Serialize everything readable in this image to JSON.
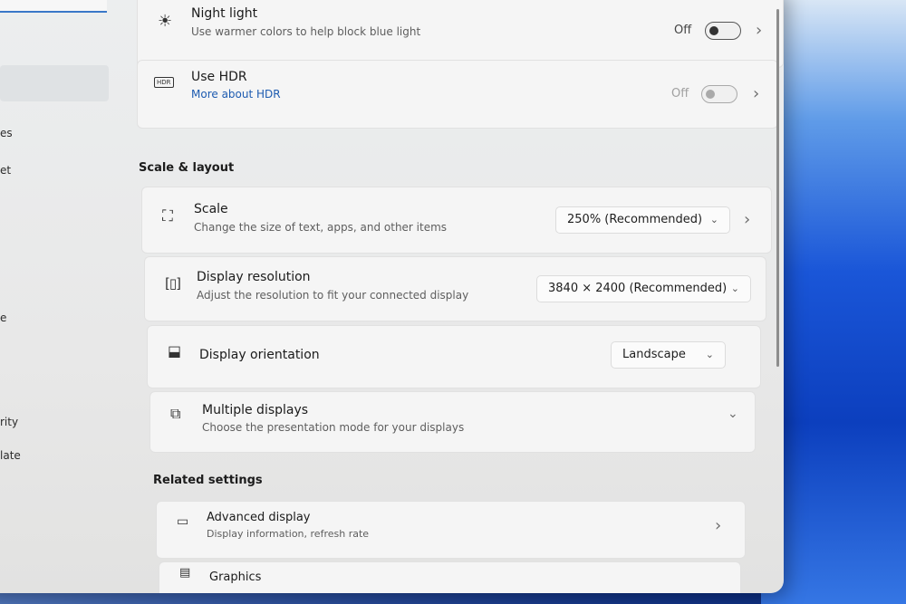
{
  "sidebar": {
    "items": [
      {
        "label": "es"
      },
      {
        "label": "et"
      },
      {
        "label": "e"
      },
      {
        "label": "rity"
      },
      {
        "label": "late"
      }
    ]
  },
  "brightness_color": {
    "night_light": {
      "title": "Night light",
      "subtitle": "Use warmer colors to help block blue light",
      "state": "Off",
      "icon": "brightness-sun-icon"
    },
    "hdr": {
      "title": "Use HDR",
      "link": "More about HDR",
      "state": "Off",
      "icon": "hdr-icon"
    }
  },
  "scale_layout": {
    "heading": "Scale & layout",
    "scale": {
      "title": "Scale",
      "subtitle": "Change the size of text, apps, and other items",
      "value": "250% (Recommended)",
      "icon": "scale-icon"
    },
    "resolution": {
      "title": "Display resolution",
      "subtitle": "Adjust the resolution to fit your connected display",
      "value": "3840 × 2400 (Recommended)",
      "icon": "resolution-icon"
    },
    "orientation": {
      "title": "Display orientation",
      "value": "Landscape",
      "icon": "orientation-icon"
    },
    "multiple_displays": {
      "title": "Multiple displays",
      "subtitle": "Choose the presentation mode for your displays",
      "icon": "multiple-displays-icon"
    }
  },
  "related": {
    "heading": "Related settings",
    "advanced_display": {
      "title": "Advanced display",
      "subtitle": "Display information, refresh rate",
      "icon": "laptop-icon"
    },
    "graphics": {
      "title": "Graphics",
      "icon": "graphics-icon"
    }
  },
  "colors": {
    "accent": "#1d5bb0",
    "toggle_off": "#333333"
  }
}
